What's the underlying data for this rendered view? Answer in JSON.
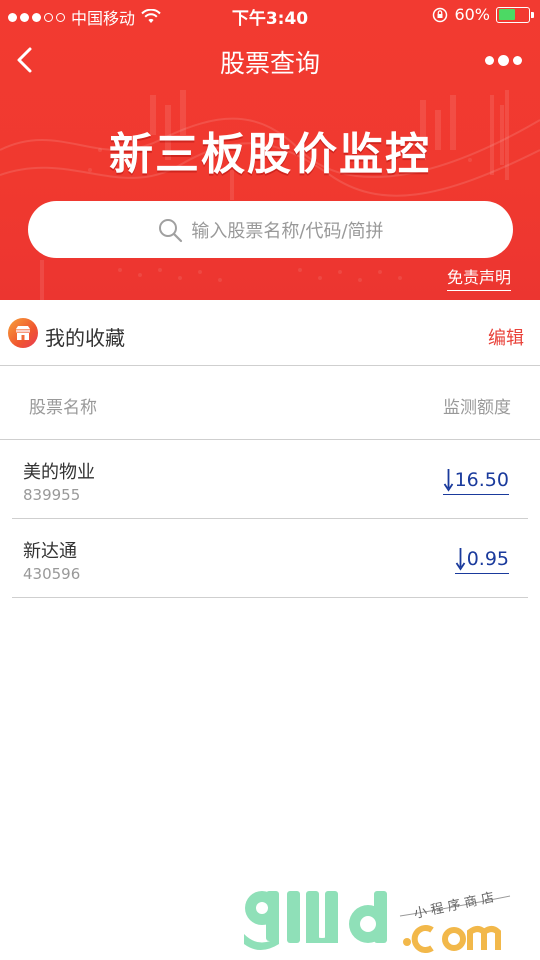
{
  "status_bar": {
    "carrier": "中国移动",
    "time": "下午3:40",
    "battery": "60%",
    "battery_level": 0.6
  },
  "nav": {
    "title": "股票查询"
  },
  "banner": {
    "title": "新三板股价监控"
  },
  "search": {
    "placeholder": "输入股票名称/代码/简拼"
  },
  "disclaimer_label": "免责声明",
  "favorites": {
    "title": "我的收藏",
    "edit_label": "编辑",
    "columns": {
      "name": "股票名称",
      "amount": "监测额度"
    },
    "items": [
      {
        "name": "美的物业",
        "code": "839955",
        "value": "16.50"
      },
      {
        "name": "新达通",
        "code": "430596",
        "value": "0.95"
      }
    ]
  },
  "colors": {
    "brand_red": "#f0392f",
    "edit_red": "#e9423a",
    "value_blue": "#1a3a9c",
    "battery_green": "#4cd964"
  },
  "icons": [
    "signal-dots-icon",
    "wifi-icon",
    "orientation-lock-icon",
    "battery-icon",
    "back-icon",
    "more-icon",
    "search-icon",
    "store-icon",
    "down-arrow-icon"
  ]
}
